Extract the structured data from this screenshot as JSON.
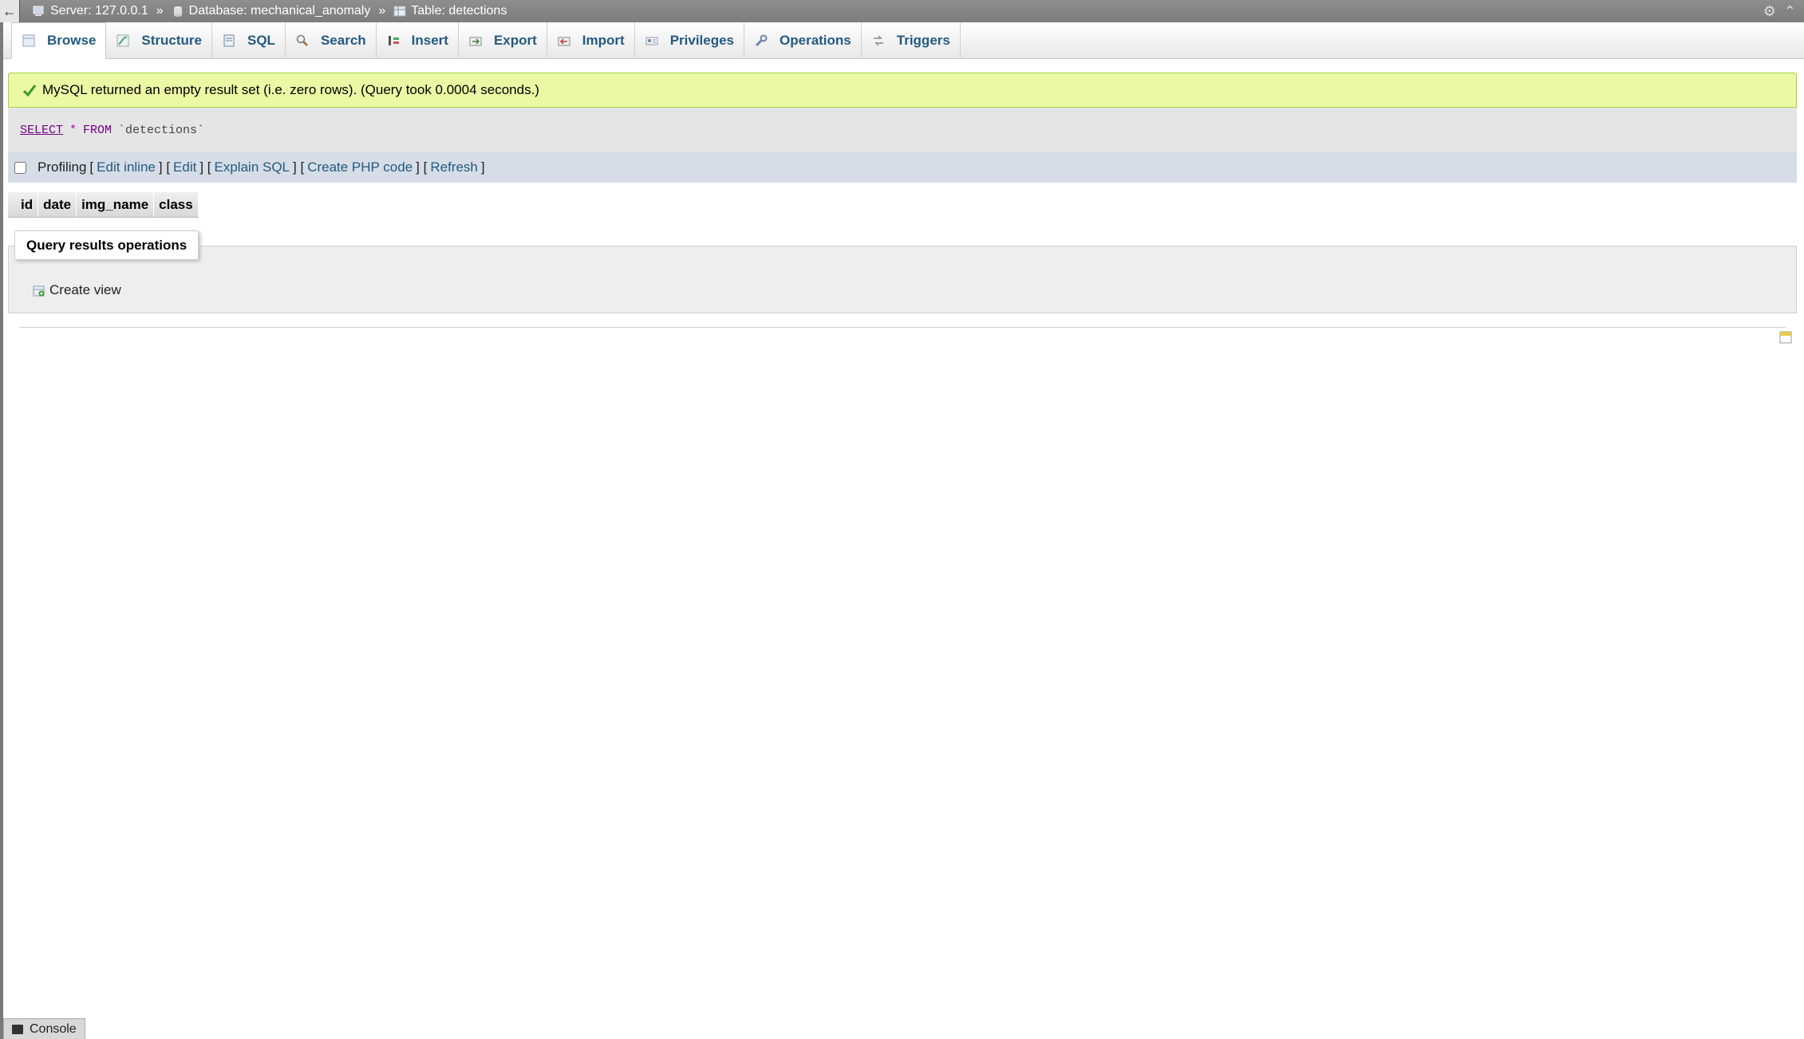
{
  "breadcrumb": {
    "server": "Server: 127.0.0.1",
    "database": "Database: mechanical_anomaly",
    "table": "Table: detections",
    "separator": "»"
  },
  "tabs": [
    {
      "label": "Browse",
      "icon": "browse-icon",
      "active": true
    },
    {
      "label": "Structure",
      "icon": "structure-icon"
    },
    {
      "label": "SQL",
      "icon": "sql-icon"
    },
    {
      "label": "Search",
      "icon": "search-icon"
    },
    {
      "label": "Insert",
      "icon": "insert-icon"
    },
    {
      "label": "Export",
      "icon": "export-icon"
    },
    {
      "label": "Import",
      "icon": "import-icon"
    },
    {
      "label": "Privileges",
      "icon": "privileges-icon"
    },
    {
      "label": "Operations",
      "icon": "operations-icon"
    },
    {
      "label": "Triggers",
      "icon": "triggers-icon"
    }
  ],
  "message": {
    "text": "MySQL returned an empty result set (i.e. zero rows). (Query took 0.0004 seconds.)",
    "color": "#ebf8a4"
  },
  "sql": {
    "select": "SELECT",
    "star": "*",
    "from": "FROM",
    "table": "`detections`"
  },
  "profiling": {
    "label": "Profiling",
    "links": {
      "edit_inline": "Edit inline",
      "edit": "Edit",
      "explain": "Explain SQL",
      "php": "Create PHP code",
      "refresh": "Refresh"
    }
  },
  "columns": [
    "id",
    "date",
    "img_name",
    "class"
  ],
  "operations": {
    "legend": "Query results operations",
    "create_view": "Create view"
  },
  "console": {
    "label": "Console"
  },
  "colors": {
    "link": "#235a81",
    "topbar": "#858585"
  }
}
